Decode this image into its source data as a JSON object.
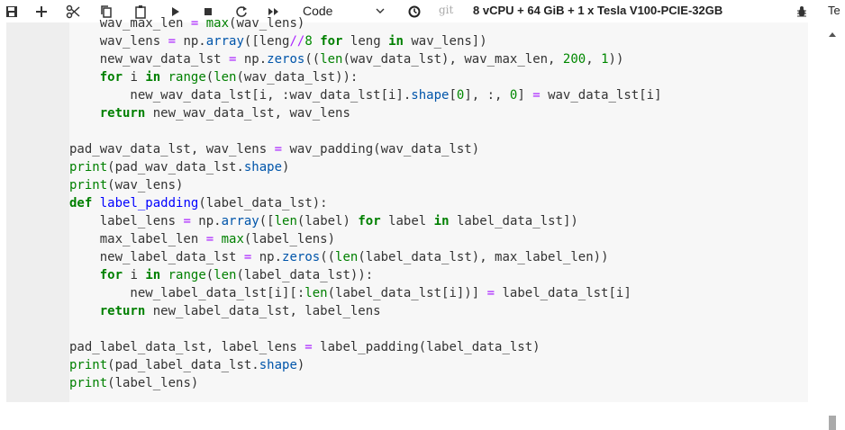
{
  "toolbar": {
    "icons": [
      "save-icon",
      "add-icon",
      "cut-icon",
      "copy-icon",
      "paste-icon",
      "run-icon",
      "stop-icon",
      "restart-icon",
      "fast-forward-icon"
    ],
    "cell_type": "Code",
    "history_icon": "clock-icon",
    "git_label": "git",
    "kernel_info": "8 vCPU + 64 GiB + 1 x Tesla V100-PCIE-32GB",
    "debug_icon": "bug-icon",
    "cut_label": "Te"
  },
  "code": {
    "lines": [
      "    wav_max_len = max(wav_lens)",
      "    wav_lens = np.array([leng//8 for leng in wav_lens])",
      "    new_wav_data_lst = np.zeros((len(wav_data_lst), wav_max_len, 200, 1))",
      "    for i in range(len(wav_data_lst)):",
      "        new_wav_data_lst[i, :wav_data_lst[i].shape[0], :, 0] = wav_data_lst[i]",
      "    return new_wav_data_lst, wav_lens",
      "",
      "pad_wav_data_lst, wav_lens = wav_padding(wav_data_lst)",
      "print(pad_wav_data_lst.shape)",
      "print(wav_lens)",
      "def label_padding(label_data_lst):",
      "    label_lens = np.array([len(label) for label in label_data_lst])",
      "    max_label_len = max(label_lens)",
      "    new_label_data_lst = np.zeros((len(label_data_lst), max_label_len))",
      "    for i in range(len(label_data_lst)):",
      "        new_label_data_lst[i][:len(label_data_lst[i])] = label_data_lst[i]",
      "    return new_label_data_lst, label_lens",
      "",
      "pad_label_data_lst, label_lens = label_padding(label_data_lst)",
      "print(pad_label_data_lst.shape)",
      "print(label_lens)"
    ]
  }
}
